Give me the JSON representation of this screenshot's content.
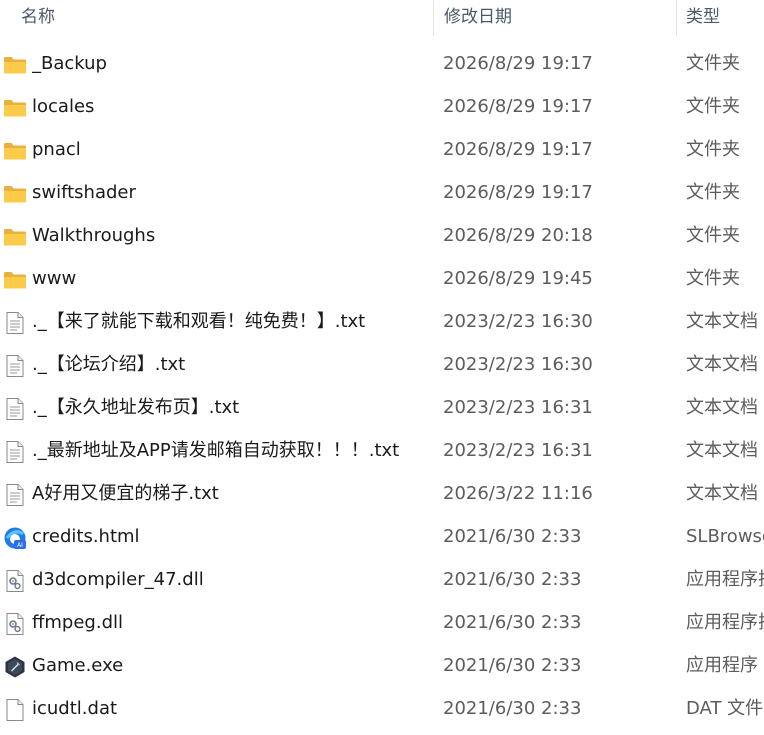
{
  "columns": {
    "name": "名称",
    "date": "修改日期",
    "type": "类型"
  },
  "sort_indicator": "^",
  "files": [
    {
      "name": "_Backup",
      "date": "2026/8/29 19:17",
      "type": "文件夹",
      "icon": "folder-icon"
    },
    {
      "name": "locales",
      "date": "2026/8/29 19:17",
      "type": "文件夹",
      "icon": "folder-icon"
    },
    {
      "name": "pnacl",
      "date": "2026/8/29 19:17",
      "type": "文件夹",
      "icon": "folder-icon"
    },
    {
      "name": "swiftshader",
      "date": "2026/8/29 19:17",
      "type": "文件夹",
      "icon": "folder-icon"
    },
    {
      "name": "Walkthroughs",
      "date": "2026/8/29 20:18",
      "type": "文件夹",
      "icon": "folder-icon"
    },
    {
      "name": "www",
      "date": "2026/8/29 19:45",
      "type": "文件夹",
      "icon": "folder-icon"
    },
    {
      "name": "._【来了就能下载和观看！纯免费！】.txt",
      "date": "2023/2/23 16:30",
      "type": "文本文档",
      "icon": "text-file-icon"
    },
    {
      "name": "._【论坛介绍】.txt",
      "date": "2023/2/23 16:30",
      "type": "文本文档",
      "icon": "text-file-icon"
    },
    {
      "name": "._【永久地址发布页】.txt",
      "date": "2023/2/23 16:31",
      "type": "文本文档",
      "icon": "text-file-icon"
    },
    {
      "name": "._最新地址及APP请发邮箱自动获取！！！.txt",
      "date": "2023/2/23 16:31",
      "type": "文本文档",
      "icon": "text-file-icon"
    },
    {
      "name": "A好用又便宜的梯子.txt",
      "date": "2026/3/22 11:16",
      "type": "文本文档",
      "icon": "text-file-icon"
    },
    {
      "name": "credits.html",
      "date": "2021/6/30 2:33",
      "type": "SLBrowser",
      "icon": "browser-html-icon"
    },
    {
      "name": "d3dcompiler_47.dll",
      "date": "2021/6/30 2:33",
      "type": "应用程序扩展",
      "icon": "dll-file-icon"
    },
    {
      "name": "ffmpeg.dll",
      "date": "2021/6/30 2:33",
      "type": "应用程序扩展",
      "icon": "dll-file-icon"
    },
    {
      "name": "Game.exe",
      "date": "2021/6/30 2:33",
      "type": "应用程序",
      "icon": "game-exe-icon"
    },
    {
      "name": "icudtl.dat",
      "date": "2021/6/30 2:33",
      "type": "DAT 文件",
      "icon": "blank-file-icon"
    }
  ]
}
